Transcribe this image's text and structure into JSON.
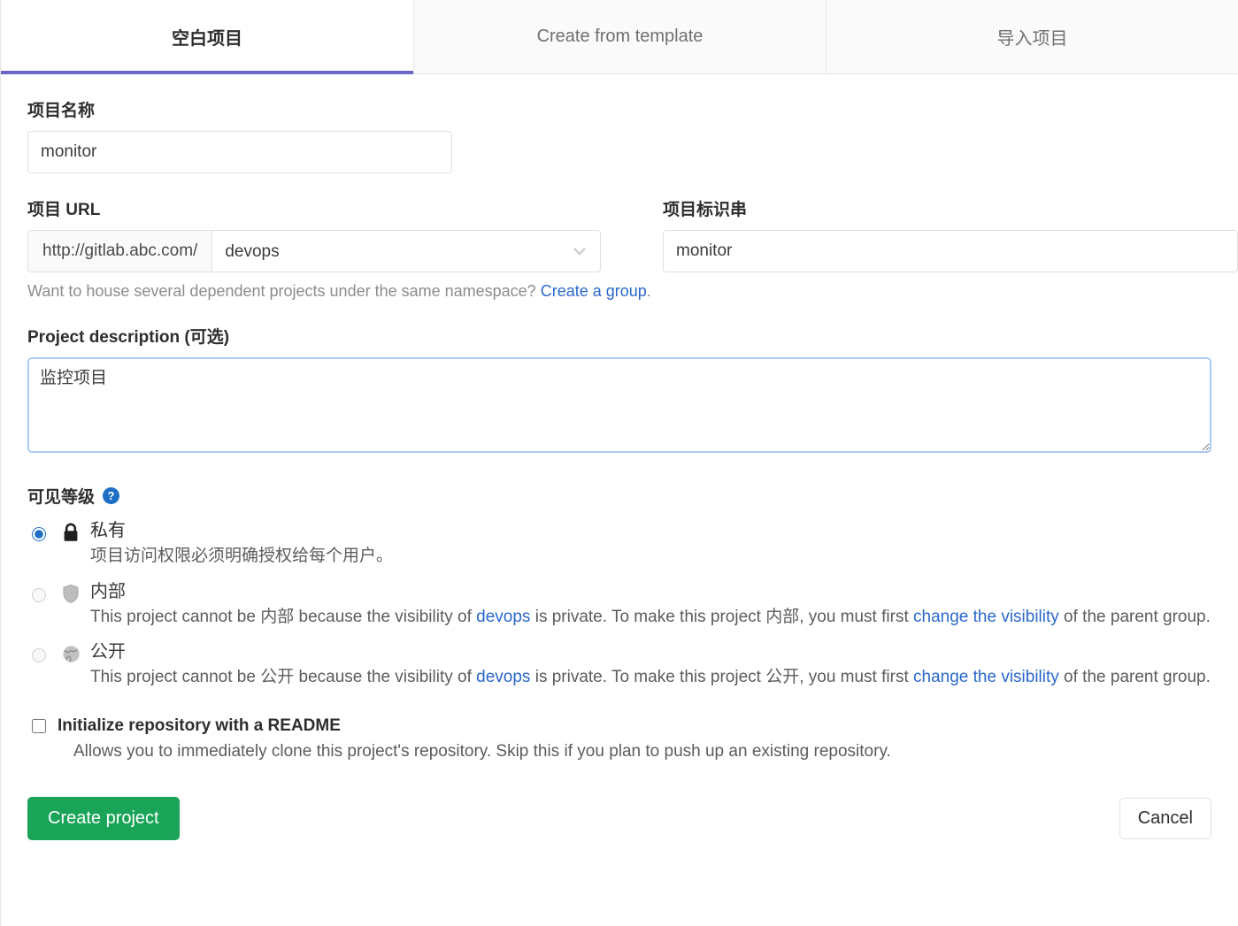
{
  "tabs": [
    {
      "id": "blank-project",
      "label": "空白项目",
      "active": true
    },
    {
      "id": "create-from-template",
      "label": "Create from template",
      "active": false
    },
    {
      "id": "import-project",
      "label": "导入项目",
      "active": false
    }
  ],
  "form": {
    "project_name": {
      "label": "项目名称",
      "value": "monitor",
      "placeholder": ""
    },
    "project_url": {
      "label": "项目 URL",
      "prefix": "http://gitlab.abc.com/",
      "namespace_selected": "devops",
      "namespace_options": [
        "devops"
      ],
      "chevron": "chevron-down-icon"
    },
    "project_slug": {
      "label": "项目标识串",
      "value": "monitor",
      "placeholder": ""
    },
    "namespace_hint": {
      "text": "Want to house several dependent projects under the same namespace? ",
      "link": "Create a group",
      "suffix": "."
    },
    "description": {
      "label": "Project description (可选)",
      "value": "监控项目",
      "placeholder": "",
      "focused": true
    }
  },
  "visibility": {
    "heading": "可见等级",
    "help_icon": "question-mark-icon",
    "options": [
      {
        "id": "private",
        "icon": "lock-icon",
        "title": "私有",
        "selected": true,
        "disabled": false,
        "desc_parts": [
          {
            "type": "text",
            "text": "项目访问权限必须明确授权给每个用户。"
          }
        ]
      },
      {
        "id": "internal",
        "icon": "shield-icon",
        "title": "内部",
        "selected": false,
        "disabled": true,
        "desc_parts": [
          {
            "type": "text",
            "text": "This project cannot be 内部 because the visibility of "
          },
          {
            "type": "link",
            "text": "devops"
          },
          {
            "type": "text",
            "text": " is private. To make this project 内部, you must first "
          },
          {
            "type": "link",
            "text": "change the visibility"
          },
          {
            "type": "text",
            "text": " of the parent group."
          }
        ]
      },
      {
        "id": "public",
        "icon": "globe-icon",
        "title": "公开",
        "selected": false,
        "disabled": true,
        "desc_parts": [
          {
            "type": "text",
            "text": "This project cannot be 公开 because the visibility of "
          },
          {
            "type": "link",
            "text": "devops"
          },
          {
            "type": "text",
            "text": " is private. To make this project 公开, you must first "
          },
          {
            "type": "link",
            "text": "change the visibility"
          },
          {
            "type": "text",
            "text": " of the parent group."
          }
        ]
      }
    ]
  },
  "readme": {
    "label": "Initialize repository with a README",
    "checked": false,
    "description": "Allows you to immediately clone this project's repository. Skip this if you plan to push up an existing repository."
  },
  "actions": {
    "create_label": "Create project",
    "cancel_label": "Cancel"
  },
  "colors": {
    "accent_tab": "#6b67c7",
    "link": "#2a68c9",
    "primary_button": "#1aa458",
    "focus_border": "#a9cdf0",
    "help_icon": "#1e6fc4"
  }
}
